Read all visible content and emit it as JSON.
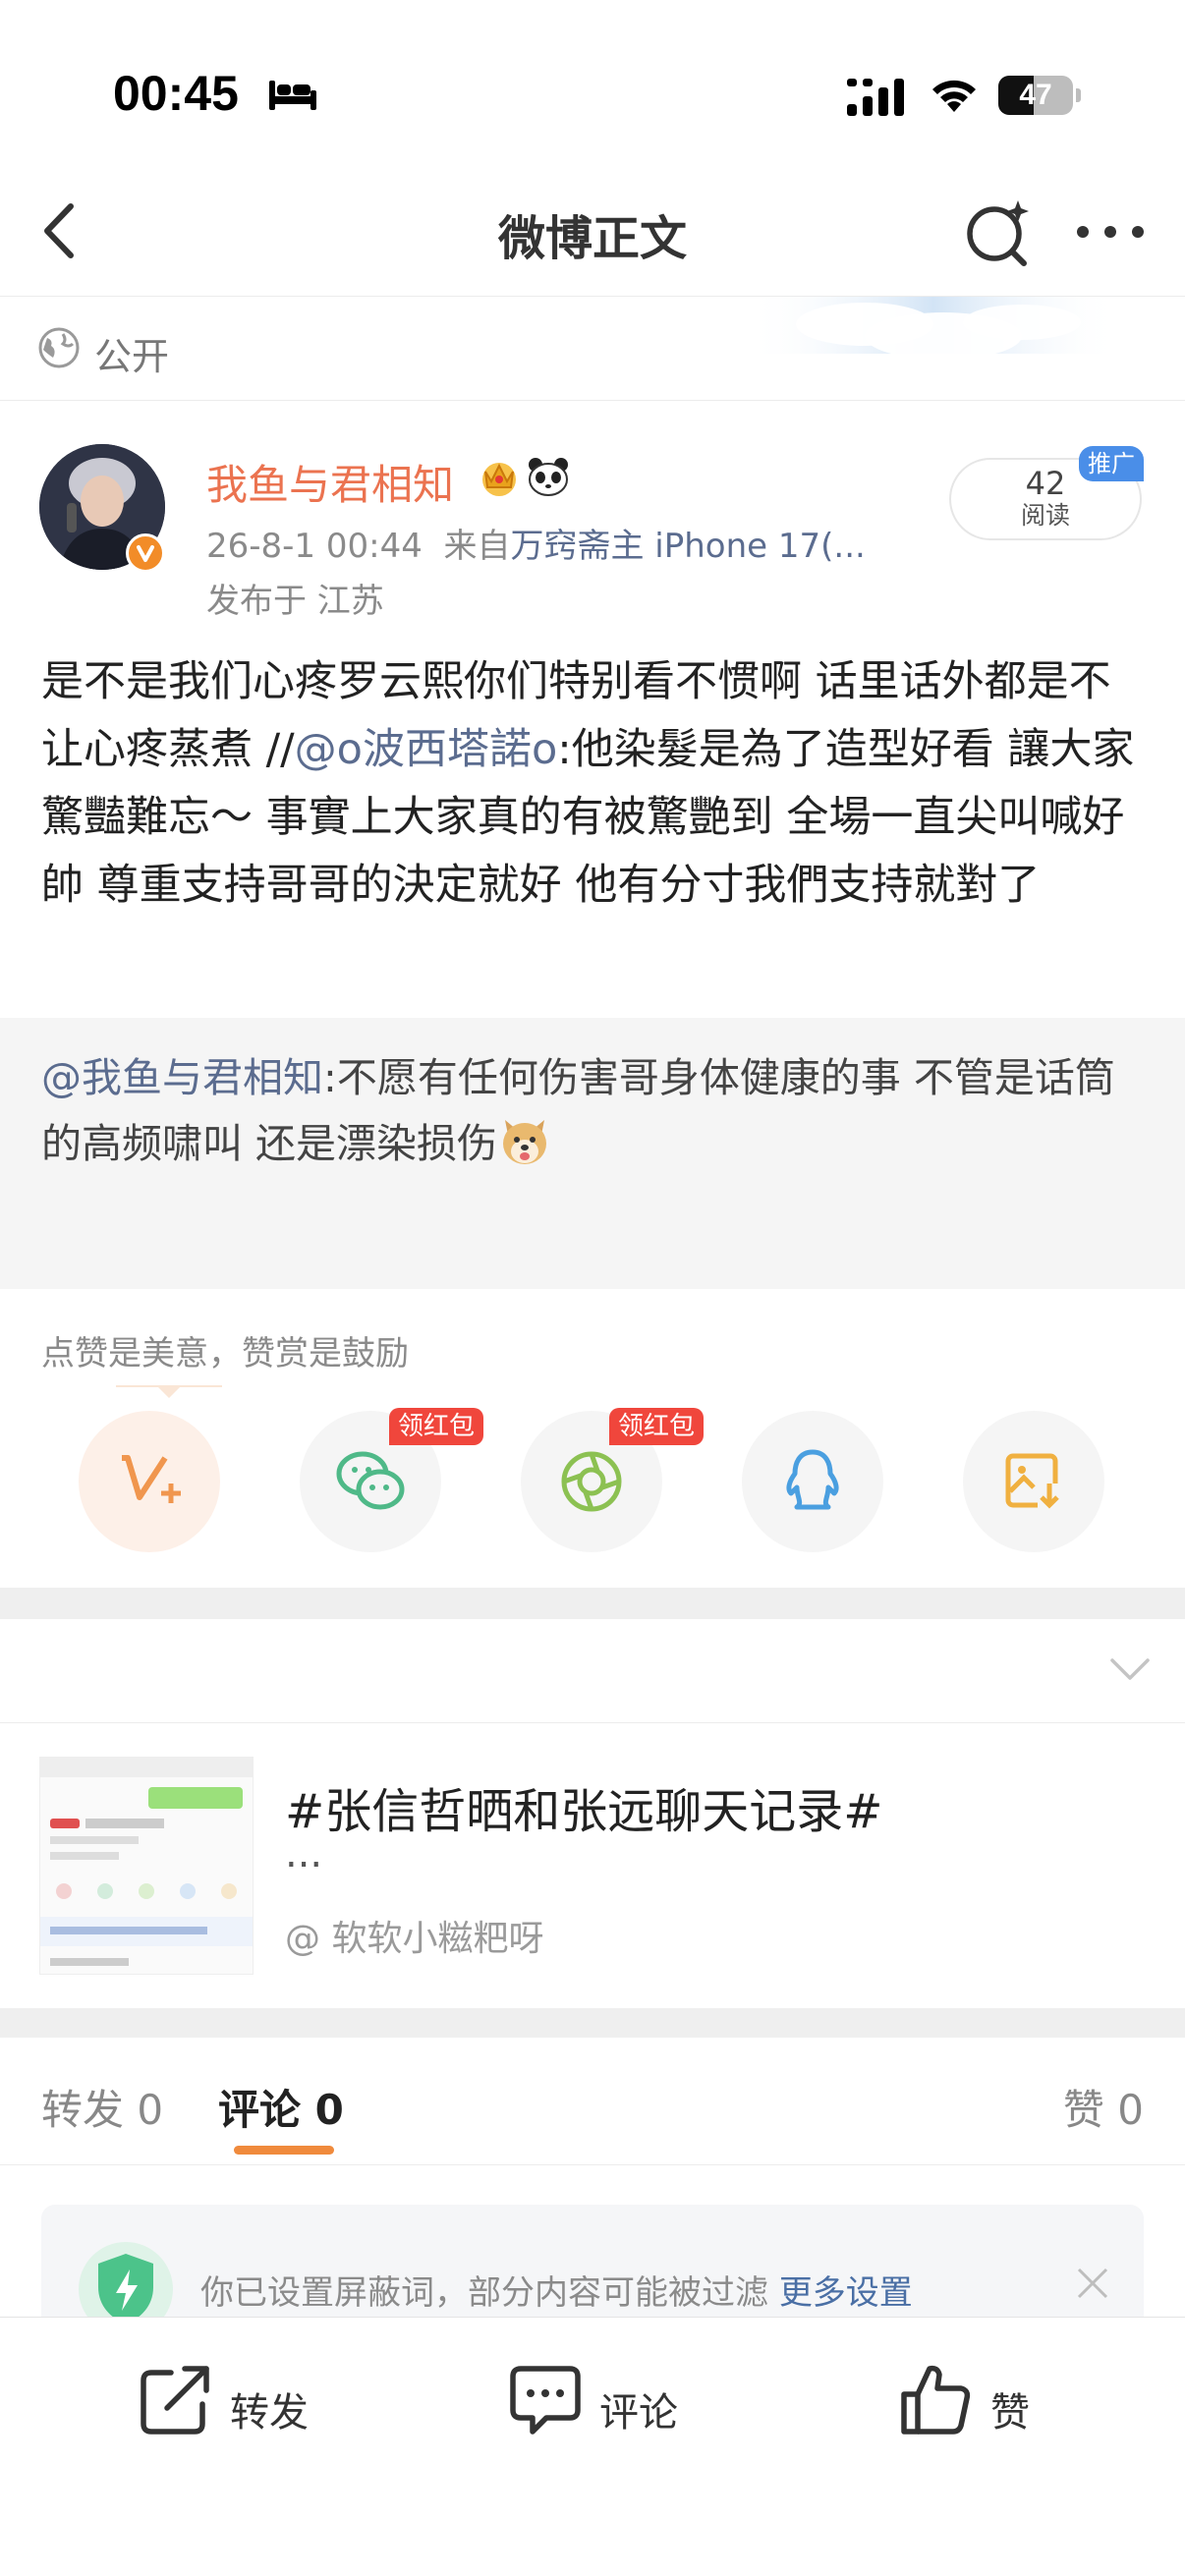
{
  "status_bar": {
    "time": "00:45",
    "battery": "47",
    "battery_level": 0.47
  },
  "nav": {
    "title": "微博正文"
  },
  "visibility": {
    "label": "公开"
  },
  "post": {
    "username": "我鱼与君相知",
    "meta_time": "26-8-1 00:44",
    "meta_from": "来自",
    "meta_source": "万窍斋主 iPhone 17(...",
    "location": "发布于 江苏",
    "read_count": "42",
    "read_label": "阅读",
    "promo_badge": "推广",
    "text_before": "是不是我们心疼罗云熙你们特别看不惯啊 话里话外都是不让心疼蒸煮 //",
    "text_mention": "@o波西塔諾o",
    "text_after": ":他染髮是為了造型好看 讓大家驚豔難忘～ 事實上大家真的有被驚艷到 全場一直尖叫喊好帥 尊重支持哥哥的決定就好 他有分寸我們支持就對了"
  },
  "repost": {
    "mention": "@我鱼与君相知",
    "text": ":不愿有任何伤害哥身体健康的事 不管是话筒的高频啸叫 还是漂染损伤"
  },
  "reward": {
    "tip": "点赞是美意，赞赏是鼓励",
    "redpack_label": "领红包"
  },
  "topic": {
    "title": "#张信哲晒和张远聊天记录#",
    "ellipsis": "...",
    "author": "@ 软软小糍粑呀"
  },
  "tabs": {
    "repost_label": "转发",
    "repost_count": "0",
    "comment_label": "评论",
    "comment_count": "0",
    "like_label": "赞",
    "like_count": "0"
  },
  "filter": {
    "text": "你已设置屏蔽词，部分内容可能被过滤",
    "link": "更多设置"
  },
  "bottom": {
    "repost": "转发",
    "comment": "评论",
    "like": "赞"
  },
  "colors": {
    "accent_orange": "#eb7350",
    "link_blue": "#5b6c8f",
    "redpack": "#f0463c",
    "promo_blue": "#4a8ee8",
    "tab_underline": "#f08a3c"
  }
}
